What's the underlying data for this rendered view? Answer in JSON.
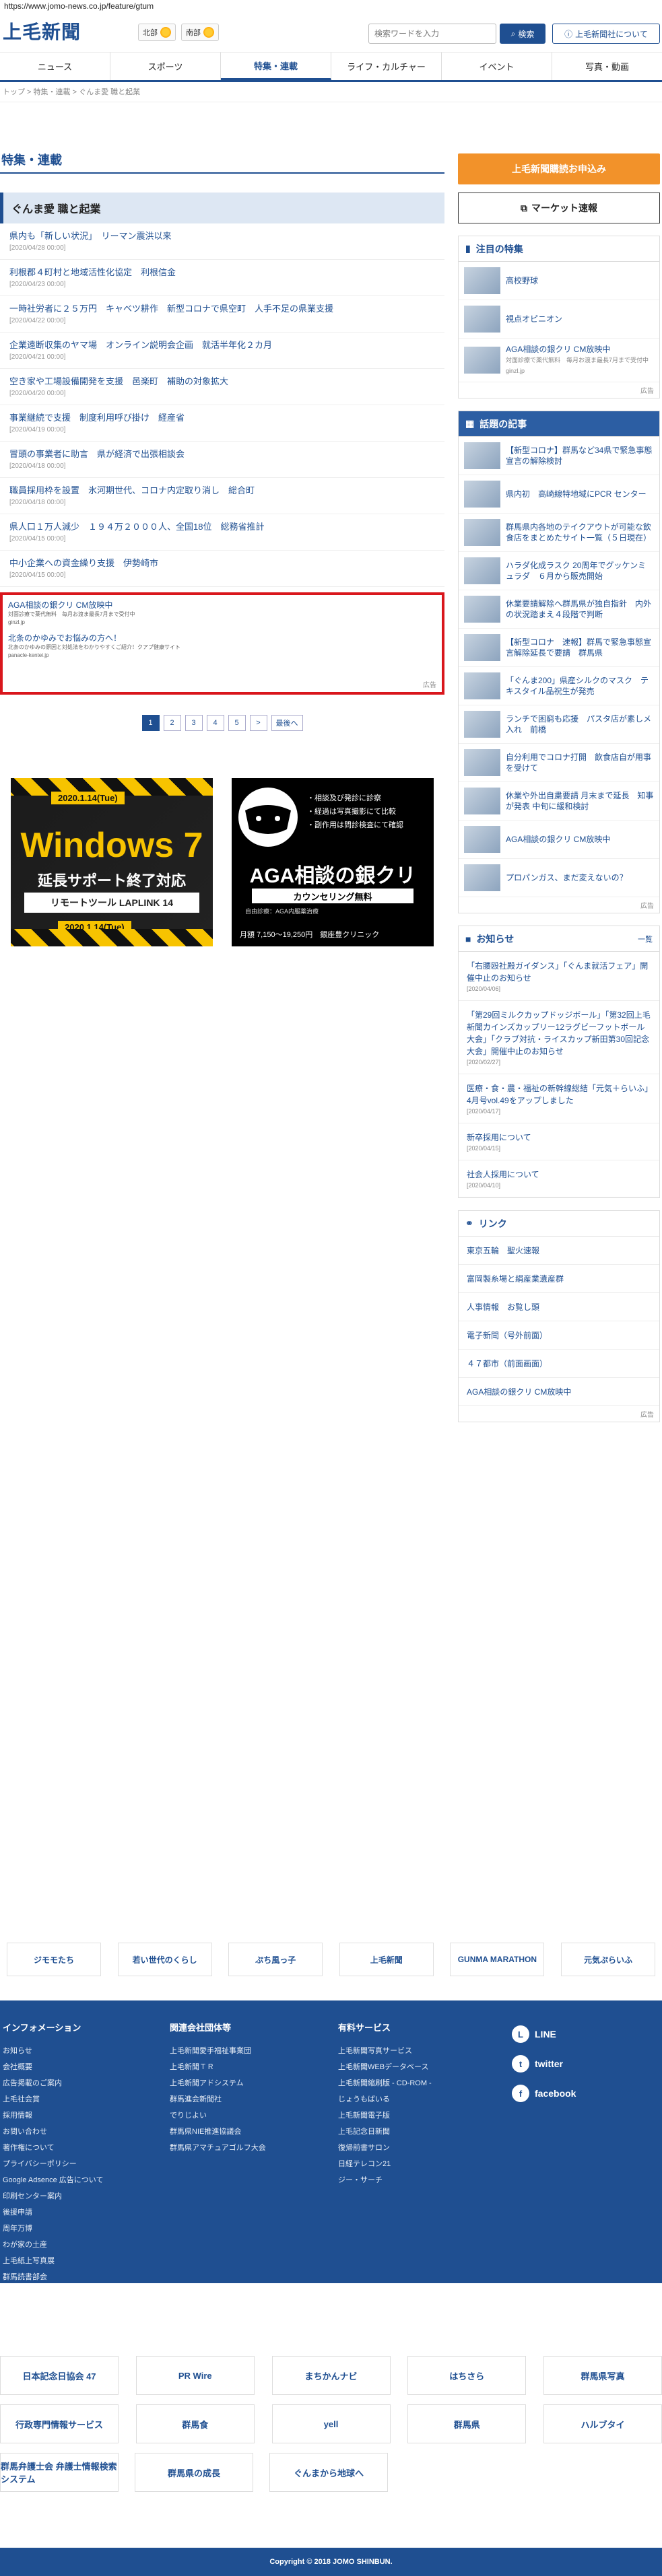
{
  "url": "https://www.jomo-news.co.jp/feature/gtum",
  "header": {
    "logo": "上毛新聞",
    "weather": [
      {
        "region": "北部"
      },
      {
        "region": "南部"
      }
    ],
    "search_placeholder": "検索ワードを入力",
    "search_label": "検索",
    "about_label": "上毛新聞社について"
  },
  "nav": [
    "ニュース",
    "スポーツ",
    "特集・連載",
    "ライフ・カルチャー",
    "イベント",
    "写真・動画"
  ],
  "breadcrumb": "トップ  >  特集・連載  >  ぐんま愛 職と起業",
  "section_title": "特集・連載",
  "category_title": "ぐんま愛 職と起業",
  "articles": [
    {
      "title": "県内も「新しい状況」　リーマン震洪以来",
      "date": "[2020/04/28 00:00]"
    },
    {
      "title": "利根郡４町村と地域活性化協定　利根信金",
      "date": "[2020/04/23 00:00]"
    },
    {
      "title": "一時社労者に２５万円　キャベツ耕作　新型コロナで県空町　人手不足の県業支援",
      "date": "[2020/04/22 00:00]"
    },
    {
      "title": "企業遠断収集のヤマ場　オンライン説明会企画　就活半年化２カ月",
      "date": "[2020/04/21 00:00]"
    },
    {
      "title": "空き家や工場設備開発を支援　邑楽町　補助の対象拡大",
      "date": "[2020/04/20 00:00]"
    },
    {
      "title": "事業継続で支援　制度利用呼び掛け　経産省",
      "date": "[2020/04/19 00:00]"
    },
    {
      "title": "冒頭の事業者に助言　県が経済で出張相談会",
      "date": "[2020/04/18 00:00]"
    },
    {
      "title": "職員採用枠を設置　氷河期世代、コロナ内定取り消し　総合町",
      "date": "[2020/04/18 00:00]"
    },
    {
      "title": "県人口１万人減少　１９４万２０００人、全国18位　総務省推計",
      "date": "[2020/04/15 00:00]"
    },
    {
      "title": "中小企業への資金繰り支援　伊勢崎市",
      "date": "[2020/04/15 00:00]"
    }
  ],
  "inline_ad": {
    "line1": "AGA相談の銀クリ CM放映中",
    "line2": "対面診療で薬代無料　毎月お渡ま最長7月まで受付中",
    "line3": "ginzl.jp",
    "line4": "北条のかゆみでお悩みの方へ！",
    "line5": "北条のかゆみの原因と対処法をわかりやすくご紹介！クアプ健康サイト",
    "line6": "panacle-kentei.jp",
    "tag": "広告"
  },
  "pager": [
    "1",
    "2",
    "3",
    "4",
    "5",
    ">",
    "最後へ"
  ],
  "banner_left": {
    "top_date": "2020.1.14(Tue)",
    "title": "Windows 7",
    "subtitle": "延長サポート終了対応",
    "remote": "リモートツール LAPLINK 14",
    "bottom_date": "2020.1.14(Tue)"
  },
  "banner_right": {
    "list": [
      "・相談及び発診に診察",
      "・経過は写真撮影にて比較",
      "・副作用は問診検査にて確認"
    ],
    "title": "AGA相談の銀クリ",
    "free": "カウンセリング無料",
    "small": "自由診療：AGA内服薬治療",
    "foot": "月額 7,150〜19,250円　銀座豊クリニック"
  },
  "sidebar": {
    "subscribe": "上毛新聞購読お申込み",
    "market": "マーケット速報",
    "featured": {
      "title": "注目の特集",
      "items": [
        {
          "title": "高校野球",
          "sub": ""
        },
        {
          "title": "視点オピニオン",
          "sub": ""
        },
        {
          "title": "AGA相談の銀クリ CM放映中",
          "sub": "対面診療で薬代無料　毎月お渡ま最長7月まで受付中 ginzl.jp"
        }
      ],
      "ad_tag": "広告"
    },
    "topics": {
      "title": "話題の記事",
      "items": [
        "【新型コロナ】群馬など34県で緊急事態宣言の解除検討",
        "県内初　高崎線特地域にPCR センター",
        "群馬県内各地のテイクアウトが可能な飲食店をまとめたサイト一覧（５日現在）",
        "ハラダ化成ラスク 20周年でグッケンミュラダ　６月から販売開始",
        "休業要請解除へ群馬県が独自指針　内外の状況踏まえ４段階で判断",
        "【新型コロナ　速報】群馬で緊急事態宣言解除延長で要請　群馬県",
        "「ぐんま200」県産シルクのマスク　テキスタイル品祝生が発売",
        "ランチで困窮も応援　パスタ店が素しメ入れ　前橋",
        "自分利用でコロナ打開　飲食店自が用事を受けて",
        "休業や外出自粛要請 月末まで延長　知事が発表 中旬に緩和検討",
        "AGA相談の銀クリ CM放映中",
        "プロパンガス、まだ変えないの？"
      ],
      "ad_tag": "広告"
    },
    "notices": {
      "title": "お知らせ",
      "more": "一覧",
      "items": [
        {
          "title": "「右腰殴社殿ガイダンス」「ぐんま就活フェア」開催中止のお知らせ",
          "date": "[2020/04/06]"
        },
        {
          "title": "「第29回ミルクカップドッジボール」「第32回上毛新聞カインズカップリー12ラグビーフットボール大会」「クラブ対抗・ライスカップ新田第30回記念大会」開催中止のお知らせ",
          "date": "[2020/02/27]"
        },
        {
          "title": "医療・食・農・福祉の新幹線総結「元気＋らいふ」4月号vol.49をアップしました",
          "date": "[2020/04/17]"
        },
        {
          "title": "新卒採用について",
          "date": "[2020/04/15]"
        },
        {
          "title": "社会人採用について",
          "date": "[2020/04/10]"
        }
      ]
    },
    "links": {
      "title": "リンク",
      "items": [
        "東京五輪　聖火速報",
        "富岡製糸場と絹産業遺産群",
        "人事情報　お覧し頭",
        "電子新聞（号外前面）",
        "４７都市（前面画面）",
        "AGA相談の銀クリ CM放映中"
      ],
      "ad_tag": "広告"
    }
  },
  "partners": [
    "ジモモたち",
    "若い世代のくらし",
    "ぷち風っ子",
    "上毛新聞",
    "GUNMA MARATHON",
    "元気ぷらいふ"
  ],
  "footer": {
    "cols": [
      {
        "title": "インフォメーション",
        "items": [
          "お知らせ",
          "会社概要",
          "広告掲載のご案内",
          "上毛社会賞",
          "採用情報",
          "お問い合わせ",
          "著作権について",
          "プライバシーポリシー",
          "Google Adsence 広告について",
          "印刷センター案内",
          "後援申請",
          "周年万博",
          "わが家の土産",
          "上毛紙上写真展",
          "群馬読書部会"
        ]
      },
      {
        "title": "関連会社団体等",
        "items": [
          "上毛新聞愛手福祉事業団",
          "上毛新聞ＴＲ",
          "上毛新聞アドシステム",
          "群馬進会新聞社",
          "でりじよい",
          "群馬県NIE推進協議会",
          "群馬県アマチュアゴルフ大会"
        ]
      },
      {
        "title": "有料サービス",
        "items": [
          "上毛新聞写真サービス",
          "上毛新聞WEBデータベース",
          "上毛新聞縮刷版 - CD-ROM -",
          "じょうもばいる",
          "上毛新聞電子版",
          "上毛記念日新聞",
          "復帰前書サロン",
          "日経テレコン21",
          "ジー・サーチ"
        ]
      }
    ],
    "social": [
      "LINE",
      "twitter",
      "facebook"
    ]
  },
  "bottom_ads": [
    [
      "日本記念日協会 47",
      "PR Wire",
      "まちかんナビ",
      "はちさら",
      "群馬県写真"
    ],
    [
      "行政専門情報サービス",
      "群馬食",
      "yell",
      "群馬県",
      "ハルブタイ"
    ],
    [
      "群馬弁護士会 弁護士情報検索システム",
      "群馬県の成長",
      "ぐんまから地球へ"
    ]
  ],
  "copyright": "Copyright © 2018 JOMO SHINBUN."
}
